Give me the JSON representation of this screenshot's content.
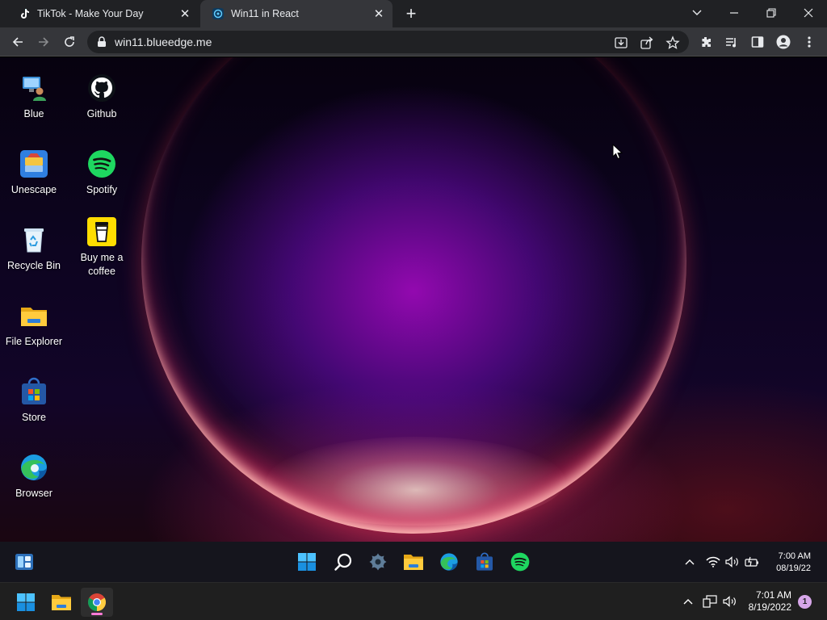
{
  "browser": {
    "tabs": [
      {
        "title": "TikTok - Make Your Day",
        "icon": "tiktok-icon",
        "active": false
      },
      {
        "title": "Win11 in React",
        "icon": "win11-react-icon",
        "active": true
      }
    ],
    "address": "win11.blueedge.me"
  },
  "desktop": {
    "icons": [
      {
        "label": "Blue",
        "icon": "user-pc-icon"
      },
      {
        "label": "Unescape",
        "icon": "unescape-icon"
      },
      {
        "label": "Recycle Bin",
        "icon": "recycle-bin-icon"
      },
      {
        "label": "File Explorer",
        "icon": "folder-icon"
      },
      {
        "label": "Store",
        "icon": "store-icon"
      },
      {
        "label": "Browser",
        "icon": "edge-icon"
      },
      {
        "label": "Github",
        "icon": "github-icon"
      },
      {
        "label": "Spotify",
        "icon": "spotify-icon"
      },
      {
        "label": "Buy me a coffee",
        "icon": "coffee-icon"
      }
    ]
  },
  "web_taskbar": {
    "pinned": [
      "start-icon",
      "search-icon",
      "settings-icon",
      "file-explorer-icon",
      "edge-icon",
      "store-icon",
      "spotify-icon"
    ],
    "time": "7:00 AM",
    "date": "08/19/22"
  },
  "host_taskbar": {
    "pinned": [
      "start-icon",
      "file-explorer-icon",
      "chrome-icon"
    ],
    "time": "7:01 AM",
    "date": "8/19/2022",
    "notification_count": "1"
  },
  "colors": {
    "accent": "#60cdff",
    "chrome_dark": "#202124",
    "chrome_toolbar": "#35363a",
    "spotify": "#1ed760"
  }
}
